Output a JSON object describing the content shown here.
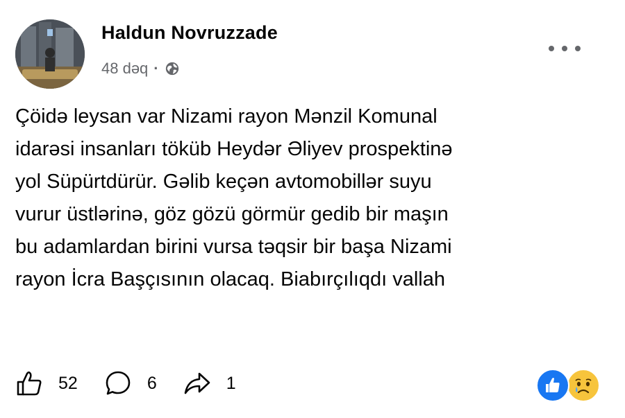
{
  "post": {
    "author": "Haldun Novruzzade",
    "time": "48 dəq",
    "separator": "·",
    "privacy_icon": "globe-icon",
    "text": "Çöidə leysan var Nizami rayon Mənzil Komunal\nidarəsi insanları töküb Heydər Əliyev prospektinə\nyol Süpürtdürür. Gəlib keçən avtomobillər suyu\nvurur üstlərinə, göz gözü görmür gedib bir maşın\nbu adamlardan birini vursa təqsir bir başa Nizami\nrayon İcra Başçısının olacaq. Biabırçılıqdı vallah"
  },
  "actions": {
    "like_count": "52",
    "comment_count": "6",
    "share_count": "1"
  },
  "reactions": [
    "like-reaction-icon",
    "sad-reaction-icon"
  ],
  "colors": {
    "text": "#050505",
    "secondary": "#65676b",
    "like_blue": "#1877f2",
    "sad_yellow": "#f7c43c"
  }
}
